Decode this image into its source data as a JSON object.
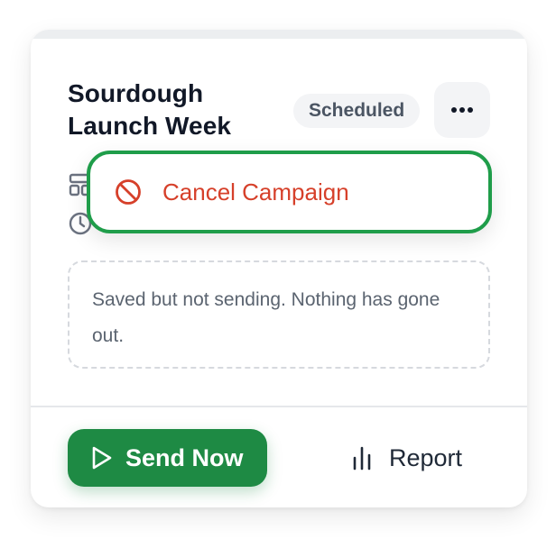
{
  "campaign": {
    "title": "Sourdough Launch Week",
    "status": "Scheduled",
    "note": "Saved but not sending. Nothing has gone out."
  },
  "actions": {
    "more_icon": "more-horizontal-icon",
    "send_label": "Send Now",
    "send_icon": "play-icon",
    "report_label": "Report",
    "report_icon": "bar-chart-icon"
  },
  "menu": {
    "cancel_label": "Cancel Campaign",
    "cancel_icon": "ban-icon"
  },
  "colors": {
    "accent": "#1e8a44",
    "focus_ring": "#1f9d4a",
    "danger": "#d6402a"
  }
}
